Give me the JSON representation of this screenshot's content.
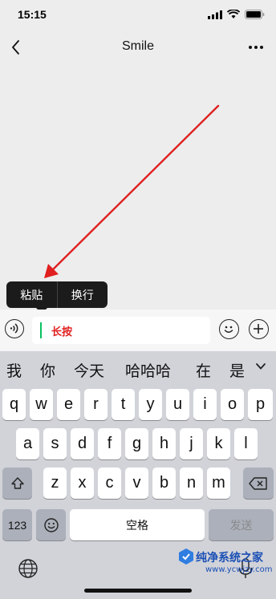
{
  "status": {
    "time": "15:15"
  },
  "nav": {
    "title": "Smile"
  },
  "popup": {
    "items": [
      "粘贴",
      "换行"
    ]
  },
  "input": {
    "value": "长按"
  },
  "candidates": [
    "我",
    "你",
    "今天",
    "哈哈哈",
    "在",
    "是"
  ],
  "keyboard": {
    "row1": [
      "q",
      "w",
      "e",
      "r",
      "t",
      "y",
      "u",
      "i",
      "o",
      "p"
    ],
    "row2": [
      "a",
      "s",
      "d",
      "f",
      "g",
      "h",
      "j",
      "k",
      "l"
    ],
    "row3": [
      "z",
      "x",
      "c",
      "v",
      "b",
      "n",
      "m"
    ],
    "num_label": "123",
    "space_label": "空格",
    "send_label": "发送"
  },
  "watermark": {
    "title": "纯净系统之家",
    "url": "www.ycwjzy.com"
  },
  "colors": {
    "accent": "#07c160",
    "annotation": "#e02020"
  },
  "icons": [
    "back-icon",
    "more-icon",
    "voice-icon",
    "emoji-icon",
    "plus-icon",
    "shift-icon",
    "backspace-icon",
    "keyboard-emoji-icon",
    "globe-icon",
    "mic-icon"
  ]
}
